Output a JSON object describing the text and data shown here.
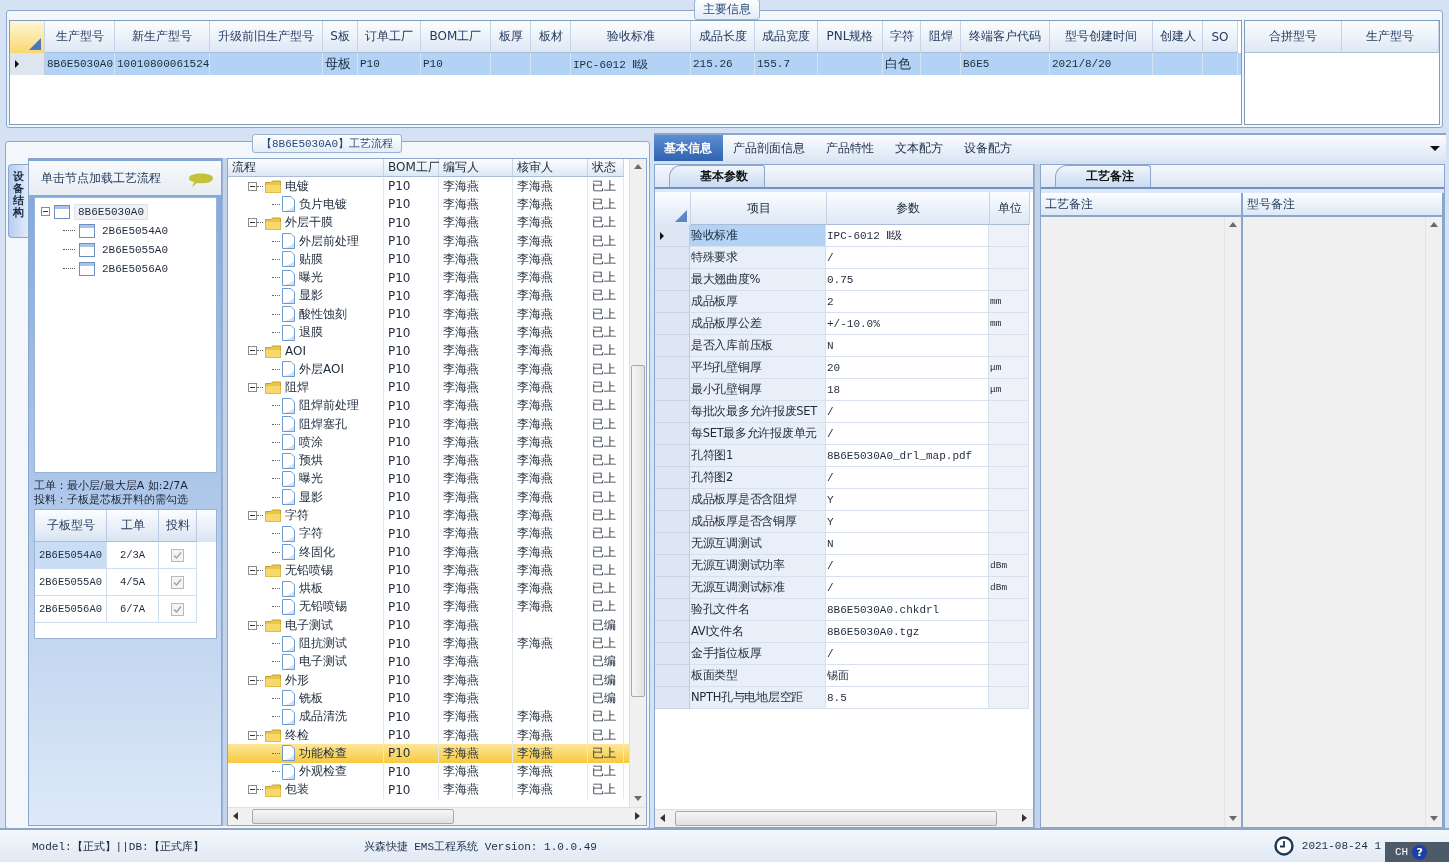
{
  "main_info": {
    "title": "主要信息",
    "table": {
      "columns": [
        "生产型号",
        "新生产型号",
        "升级前旧生产型号",
        "S板",
        "订单工厂",
        "BOM工厂",
        "板厚",
        "板材",
        "验收标准",
        "成品长度",
        "成品宽度",
        "PNL规格",
        "字符",
        "阻焊",
        "终端客户代码",
        "型号创建时间",
        "创建人",
        "SO"
      ],
      "rows": [
        {
          "selected": true,
          "cells": [
            "8B6E5030A0",
            "10010800061524",
            null,
            "母板",
            "P10",
            "P10",
            null,
            null,
            "IPC-6012 Ⅱ级",
            "215.26",
            "155.7",
            null,
            "白色",
            null,
            "B6E5",
            "2021/8/20",
            null,
            null
          ]
        }
      ]
    },
    "merge_table": {
      "columns": [
        "合拼型号",
        "生产型号"
      ]
    }
  },
  "process_panel": {
    "title": "【8B6E5030A0】工艺流程",
    "side_tab": {
      "label": "设备结构",
      "selected": true
    },
    "hint": "单击节点加载工艺流程",
    "board_tree": [
      {
        "label": "8B6E5030A0",
        "expanded": true,
        "selected": true,
        "children": [
          {
            "label": "2B6E5054A0",
            "selected": false
          },
          {
            "label": "2B6E5055A0",
            "selected": false
          },
          {
            "label": "2B6E5056A0",
            "selected": false
          }
        ]
      }
    ],
    "notes": [
      "工单：最小层/最大层A 如:2/7A",
      "投料：子板是芯板开料的需勾选"
    ],
    "sub_boards": {
      "columns": [
        "子板型号",
        "工单",
        "投料"
      ],
      "rows": [
        {
          "board": "2B6E5054A0",
          "order": "2/3A",
          "checked": true,
          "selected": true
        },
        {
          "board": "2B6E5055A0",
          "order": "4/5A",
          "checked": true,
          "selected": false
        },
        {
          "board": "2B6E5056A0",
          "order": "6/7A",
          "checked": true,
          "selected": false
        }
      ]
    },
    "flow_grid": {
      "columns": [
        "流程",
        "BOM工厂",
        "编写人",
        "核审人",
        "状态"
      ],
      "rows": [
        {
          "label": "电镀",
          "bom": "P10",
          "writer": "李海燕",
          "reviewer": "李海燕",
          "status": "已上",
          "expanded": true,
          "selected": false,
          "children": [
            {
              "label": "负片电镀",
              "bom": "P10",
              "writer": "李海燕",
              "reviewer": "李海燕",
              "status": "已上",
              "selected": false
            }
          ]
        },
        {
          "label": "外层干膜",
          "bom": "P10",
          "writer": "李海燕",
          "reviewer": "李海燕",
          "status": "已上",
          "expanded": true,
          "selected": false,
          "children": [
            {
              "label": "外层前处理",
              "bom": "P10",
              "writer": "李海燕",
              "reviewer": "李海燕",
              "status": "已上",
              "selected": false
            },
            {
              "label": "贴膜",
              "bom": "P10",
              "writer": "李海燕",
              "reviewer": "李海燕",
              "status": "已上",
              "selected": false
            },
            {
              "label": "曝光",
              "bom": "P10",
              "writer": "李海燕",
              "reviewer": "李海燕",
              "status": "已上",
              "selected": false
            },
            {
              "label": "显影",
              "bom": "P10",
              "writer": "李海燕",
              "reviewer": "李海燕",
              "status": "已上",
              "selected": false
            },
            {
              "label": "酸性蚀刻",
              "bom": "P10",
              "writer": "李海燕",
              "reviewer": "李海燕",
              "status": "已上",
              "selected": false
            },
            {
              "label": "退膜",
              "bom": "P10",
              "writer": "李海燕",
              "reviewer": "李海燕",
              "status": "已上",
              "selected": false
            }
          ]
        },
        {
          "label": "AOI",
          "bom": "P10",
          "writer": "李海燕",
          "reviewer": "李海燕",
          "status": "已上",
          "expanded": true,
          "selected": false,
          "children": [
            {
              "label": "外层AOI",
              "bom": "P10",
              "writer": "李海燕",
              "reviewer": "李海燕",
              "status": "已上",
              "selected": false
            }
          ]
        },
        {
          "label": "阻焊",
          "bom": "P10",
          "writer": "李海燕",
          "reviewer": "李海燕",
          "status": "已上",
          "expanded": true,
          "selected": false,
          "children": [
            {
              "label": "阻焊前处理",
              "bom": "P10",
              "writer": "李海燕",
              "reviewer": "李海燕",
              "status": "已上",
              "selected": false
            },
            {
              "label": "阻焊塞孔",
              "bom": "P10",
              "writer": "李海燕",
              "reviewer": "李海燕",
              "status": "已上",
              "selected": false
            },
            {
              "label": "喷涂",
              "bom": "P10",
              "writer": "李海燕",
              "reviewer": "李海燕",
              "status": "已上",
              "selected": false
            },
            {
              "label": "预烘",
              "bom": "P10",
              "writer": "李海燕",
              "reviewer": "李海燕",
              "status": "已上",
              "selected": false
            },
            {
              "label": "曝光",
              "bom": "P10",
              "writer": "李海燕",
              "reviewer": "李海燕",
              "status": "已上",
              "selected": false
            },
            {
              "label": "显影",
              "bom": "P10",
              "writer": "李海燕",
              "reviewer": "李海燕",
              "status": "已上",
              "selected": false
            }
          ]
        },
        {
          "label": "字符",
          "bom": "P10",
          "writer": "李海燕",
          "reviewer": "李海燕",
          "status": "已上",
          "expanded": true,
          "selected": false,
          "children": [
            {
              "label": "字符",
              "bom": "P10",
              "writer": "李海燕",
              "reviewer": "李海燕",
              "status": "已上",
              "selected": false
            },
            {
              "label": "终固化",
              "bom": "P10",
              "writer": "李海燕",
              "reviewer": "李海燕",
              "status": "已上",
              "selected": false
            }
          ]
        },
        {
          "label": "无铅喷锡",
          "bom": "P10",
          "writer": "李海燕",
          "reviewer": "李海燕",
          "status": "已上",
          "expanded": true,
          "selected": false,
          "children": [
            {
              "label": "烘板",
              "bom": "P10",
              "writer": "李海燕",
              "reviewer": "李海燕",
              "status": "已上",
              "selected": false
            },
            {
              "label": "无铅喷锡",
              "bom": "P10",
              "writer": "李海燕",
              "reviewer": "李海燕",
              "status": "已上",
              "selected": false
            }
          ]
        },
        {
          "label": "电子测试",
          "bom": "P10",
          "writer": "李海燕",
          "status": "已编",
          "expanded": true,
          "selected": false,
          "children": [
            {
              "label": "阻抗测试",
              "bom": "P10",
              "writer": "李海燕",
              "reviewer": "李海燕",
              "status": "已上",
              "selected": false
            },
            {
              "label": "电子测试",
              "bom": "P10",
              "writer": "李海燕",
              "status": "已编",
              "selected": false
            }
          ]
        },
        {
          "label": "外形",
          "bom": "P10",
          "writer": "李海燕",
          "status": "已编",
          "expanded": true,
          "selected": false,
          "children": [
            {
              "label": "铣板",
              "bom": "P10",
              "writer": "李海燕",
              "status": "已编",
              "selected": false
            },
            {
              "label": "成品清洗",
              "bom": "P10",
              "writer": "李海燕",
              "reviewer": "李海燕",
              "status": "已上",
              "selected": false
            }
          ]
        },
        {
          "label": "终检",
          "bom": "P10",
          "writer": "李海燕",
          "reviewer": "李海燕",
          "status": "已上",
          "expanded": true,
          "selected": false,
          "children": [
            {
              "label": "功能检查",
              "bom": "P10",
              "writer": "李海燕",
              "reviewer": "李海燕",
              "status": "已上",
              "selected": true
            },
            {
              "label": "外观检查",
              "bom": "P10",
              "writer": "李海燕",
              "reviewer": "李海燕",
              "status": "已上",
              "selected": false
            }
          ]
        },
        {
          "label": "包装",
          "bom": "P10",
          "writer": "李海燕",
          "reviewer": "李海燕",
          "status": "已上",
          "expanded": true,
          "selected": false
        }
      ]
    }
  },
  "detail_panel": {
    "tabs": [
      {
        "label": "基本信息",
        "selected": true
      },
      {
        "label": "产品剖面信息",
        "selected": false
      },
      {
        "label": "产品特性",
        "selected": false
      },
      {
        "label": "文本配方",
        "selected": false
      },
      {
        "label": "设备配方",
        "selected": false
      }
    ],
    "params": {
      "tab": "基本参数",
      "columns": [
        "项目",
        "参数",
        "单位"
      ],
      "rows": [
        {
          "item": "验收标准",
          "value": "IPC-6012 Ⅱ级",
          "selected": true
        },
        {
          "item": "特殊要求",
          "value": "/",
          "selected": false
        },
        {
          "item": "最大翘曲度%",
          "value": "0.75",
          "selected": false
        },
        {
          "item": "成品板厚",
          "value": "2",
          "unit": "mm",
          "selected": false
        },
        {
          "item": "成品板厚公差",
          "value": "+/-10.0%",
          "unit": "mm",
          "selected": false
        },
        {
          "item": "是否入库前压板",
          "value": "N",
          "selected": false
        },
        {
          "item": "平均孔壁铜厚",
          "value": "20",
          "unit": "μm",
          "selected": false
        },
        {
          "item": "最小孔壁铜厚",
          "value": "18",
          "unit": "μm",
          "selected": false
        },
        {
          "item": "每批次最多允许报废SET",
          "value": "/",
          "selected": false
        },
        {
          "item": "每SET最多允许报废单元",
          "value": "/",
          "selected": false
        },
        {
          "item": "孔符图1",
          "value": "8B6E5030A0_drl_map.pdf",
          "selected": false
        },
        {
          "item": "孔符图2",
          "value": "/",
          "selected": false
        },
        {
          "item": "成品板厚是否含阻焊",
          "value": "Y",
          "selected": false
        },
        {
          "item": "成品板厚是否含铜厚",
          "value": "Y",
          "selected": false
        },
        {
          "item": "无源互调测试",
          "value": "N",
          "selected": false
        },
        {
          "item": "无源互调测试功率",
          "value": "/",
          "unit": "dBm",
          "selected": false
        },
        {
          "item": "无源互调测试标准",
          "value": "/",
          "unit": "dBm",
          "selected": false
        },
        {
          "item": "验孔文件名",
          "value": "8B6E5030A0.chkdrl",
          "selected": false
        },
        {
          "item": "AVI文件名",
          "value": "8B6E5030A0.tgz",
          "selected": false
        },
        {
          "item": "金手指位板厚",
          "value": "/",
          "selected": false
        },
        {
          "item": "板面类型",
          "value": "锡面",
          "selected": false
        },
        {
          "item": "NPTH孔与电地层空距",
          "value": "8.5",
          "selected": false
        }
      ]
    },
    "remarks": {
      "tab": "工艺备注",
      "columns": [
        "工艺备注",
        "型号备注"
      ]
    }
  },
  "status_bar": {
    "mode": "Model:【正式】||DB:【正式库】",
    "app": "兴森快捷 EMS工程系统 Version: 1.0.0.49",
    "datetime": "2021-08-24 1",
    "language": "CH",
    "help": "?"
  }
}
